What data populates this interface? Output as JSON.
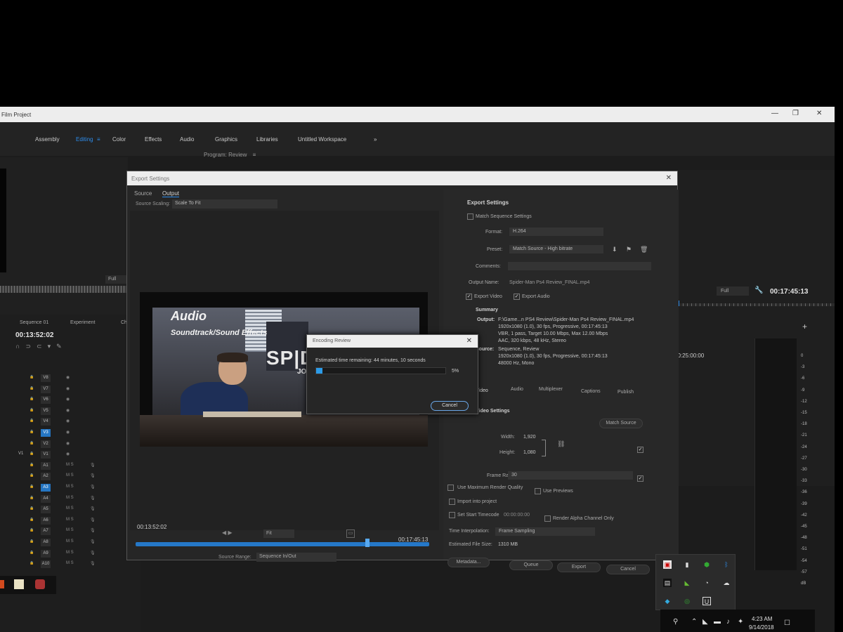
{
  "window": {
    "title": "Film Project",
    "minimize": "—",
    "restore": "❐",
    "close": "✕"
  },
  "workspaces": [
    {
      "label": "Assembly"
    },
    {
      "label": "Editing"
    },
    {
      "label": "Color"
    },
    {
      "label": "Effects"
    },
    {
      "label": "Audio"
    },
    {
      "label": "Graphics"
    },
    {
      "label": "Libraries"
    },
    {
      "label": "Untitled Workspace"
    },
    {
      "label": "»"
    }
  ],
  "workspace_menu": "≡",
  "source_monitor": {
    "zoom": "Full"
  },
  "program_monitor": {
    "title": "Program: Review",
    "menu": "≡",
    "zoom": "Full",
    "timecode": "00:17:45:13"
  },
  "timeline": {
    "tabs": [
      "Sequence 01",
      "Experiment",
      "Ch"
    ],
    "timecode": "00:13:52:02",
    "ruler": "00:25:00:00",
    "tracks": [
      "V8",
      "V7",
      "V6",
      "V5",
      "V4",
      "V3",
      "V2",
      "V1",
      "A1",
      "A2",
      "A3",
      "A4",
      "A5",
      "A6",
      "A7",
      "A8",
      "A9",
      "A10"
    ],
    "active_tracks": [
      "V3",
      "A3"
    ],
    "v1_target": "V1"
  },
  "meter": {
    "labels": [
      "0",
      "-3",
      "-6",
      "-9",
      "-12",
      "-15",
      "-18",
      "-21",
      "-24",
      "-27",
      "-30",
      "-33",
      "-36",
      "-39",
      "-42",
      "-45",
      "-48",
      "-51",
      "-54",
      "-57",
      "dB"
    ]
  },
  "export_dialog": {
    "title": "Export Settings",
    "close": "✕",
    "tabs": [
      {
        "label": "Source"
      },
      {
        "label": "Output"
      }
    ],
    "source_scaling_label": "Source Scaling:",
    "source_scaling_value": "Scale To Fit",
    "preview": {
      "title": "Audio",
      "subtitle": "Soundtrack/Sound Effects",
      "logo_text": "SP|DE",
      "joh_text": "JOH"
    },
    "in_timecode": "00:13:52:02",
    "out_timecode": "00:17:45:13",
    "fit": "Fit",
    "playhead_fraction": 0.79,
    "source_range_label": "Source Range:",
    "source_range_value": "Sequence In/Out"
  },
  "export_settings": {
    "heading": "Export Settings",
    "match_sequence": "Match Sequence Settings",
    "format_label": "Format:",
    "format_value": "H.264",
    "preset_label": "Preset:",
    "preset_value": "Match Source - High bitrate",
    "comments_label": "Comments:",
    "output_name_label": "Output Name:",
    "output_name_value": "Spider-Man Ps4 Review_FINAL.mp4",
    "export_video": "Export Video",
    "export_audio": "Export Audio",
    "summary_heading": "Summary",
    "output_label": "Output:",
    "output_lines": [
      "F:\\Game...n PS4 Review\\Spider-Man Ps4 Review_FINAL.mp4",
      "1920x1080 (1.0), 30 fps, Progressive, 00:17:45:13",
      "VBR, 1 pass, Target 10.00 Mbps, Max 12.00 Mbps",
      "AAC, 320 kbps, 48 kHz, Stereo"
    ],
    "source_label": "Source:",
    "source_lines": [
      "Sequence, Review",
      "1920x1080 (1.0), 30 fps, Progressive, 00:17:45:13",
      "48000 Hz, Mono"
    ],
    "tabs": [
      "Video",
      "Audio",
      "Multiplexer",
      "Captions",
      "Publish"
    ],
    "video_settings_heading": "Video Settings",
    "match_source_button": "Match Source",
    "width_label": "Width:",
    "width_value": "1,920",
    "height_label": "Height:",
    "height_value": "1,080",
    "frame_rate_label": "Frame Rate:",
    "frame_rate_value": "30",
    "max_render": "Use Maximum Render Quality",
    "use_previews": "Use Previews",
    "import_project": "Import into project",
    "set_start_tc": "Set Start Timecode",
    "start_tc_value": "00:00:00:00",
    "render_alpha": "Render Alpha Channel Only",
    "time_interp_label": "Time Interpolation:",
    "time_interp_value": "Frame Sampling",
    "file_size_label": "Estimated File Size:",
    "file_size_value": "1310 MB",
    "buttons": {
      "metadata": "Metadata...",
      "queue": "Queue",
      "export": "Export",
      "cancel": "Cancel"
    }
  },
  "encoding_dialog": {
    "title": "Encoding Review",
    "close": "✕",
    "time_remaining": "Estimated time remaining: 44 minutes, 10 seconds",
    "progress_percent": 5,
    "progress_label": "5%",
    "cancel": "Cancel"
  },
  "system_tray": {
    "time": "4:23 AM",
    "date": "9/14/2018",
    "icons": [
      "nvidia-icon",
      "network-icon",
      "volume-icon",
      "dropbox-icon",
      "notification-icon"
    ]
  },
  "colors": {
    "accent": "#2d8ceb",
    "progress": "#2c9be8",
    "dialog_bg": "#262626"
  }
}
